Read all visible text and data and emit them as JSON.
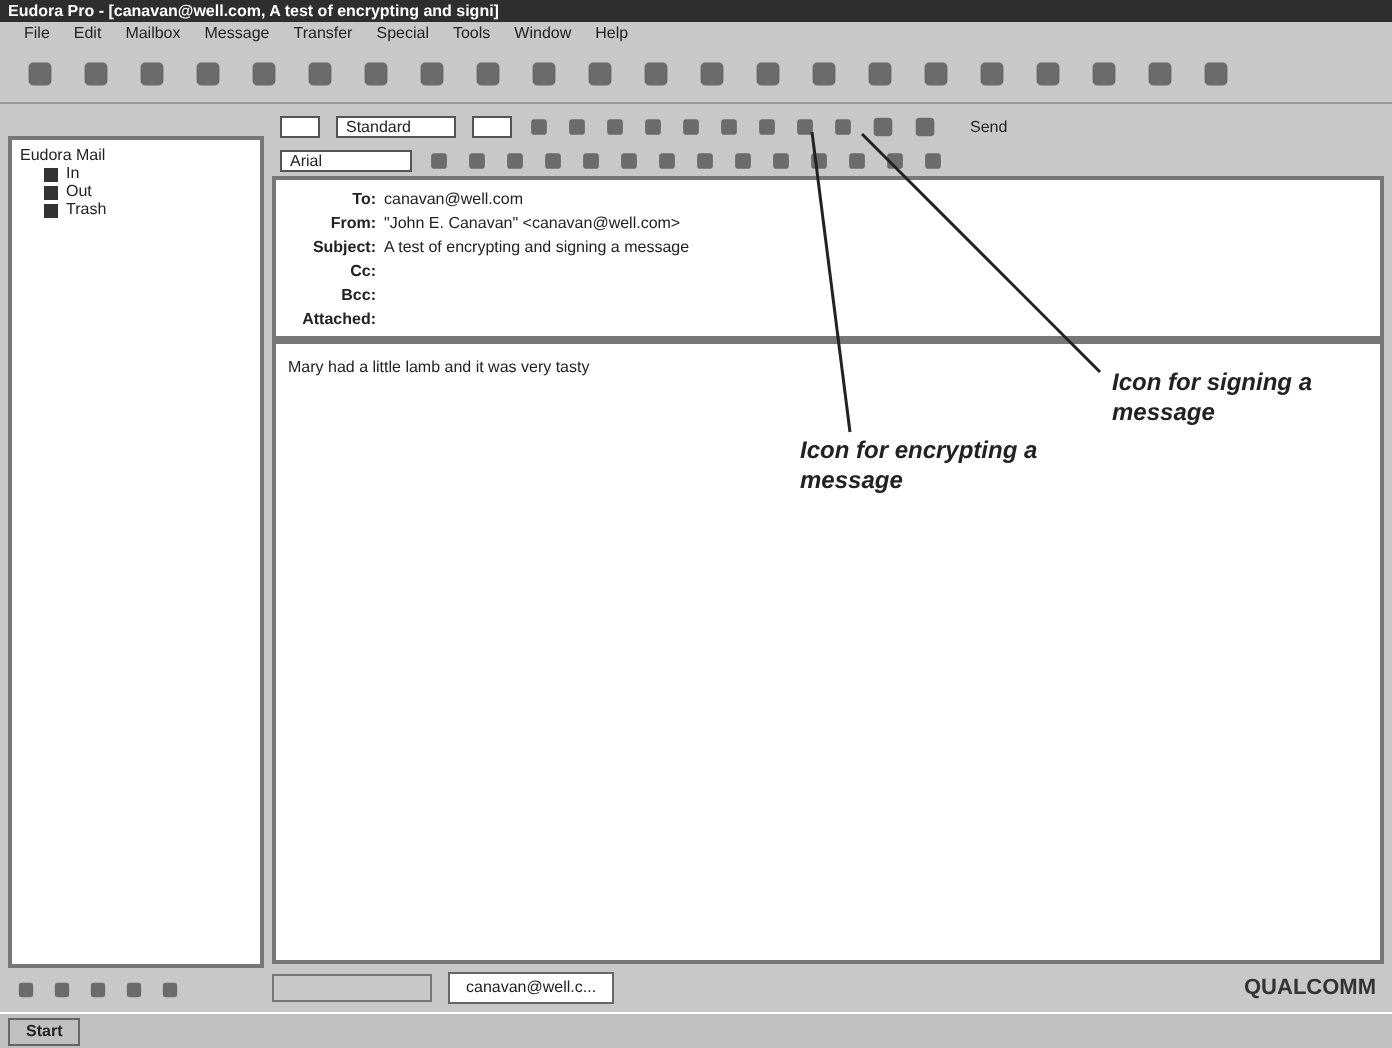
{
  "window": {
    "title": "Eudora Pro - [canavan@well.com, A test of encrypting and signi]"
  },
  "menu": [
    "File",
    "Edit",
    "Mailbox",
    "Message",
    "Transfer",
    "Special",
    "Tools",
    "Window",
    "Help"
  ],
  "format_bar": {
    "priority": "Standard",
    "font": "Arial",
    "send": "Send"
  },
  "tree": {
    "label": "Eudora Mail",
    "children": [
      {
        "label": "In"
      },
      {
        "label": "Out"
      },
      {
        "label": "Trash"
      }
    ]
  },
  "headers": [
    {
      "label": "To:",
      "value": "canavan@well.com"
    },
    {
      "label": "From:",
      "value": "\"John E. Canavan\" <canavan@well.com>"
    },
    {
      "label": "Subject:",
      "value": "A test of encrypting and signing a message"
    },
    {
      "label": "Cc:"
    },
    {
      "label": "Bcc:"
    },
    {
      "label": "Attached:"
    }
  ],
  "body": "Mary had a little lamb and it was very tasty",
  "annotations": [
    {
      "kind": "encrypt",
      "text": "Icon for encrypting a message"
    },
    {
      "kind": "sign",
      "text": "Icon for signing a message"
    }
  ],
  "window_tabs": [
    {
      "label": "canavan@well.c...",
      "selected": true
    }
  ],
  "brand": "QUALCOMM",
  "taskbar": {
    "start": "Start"
  }
}
